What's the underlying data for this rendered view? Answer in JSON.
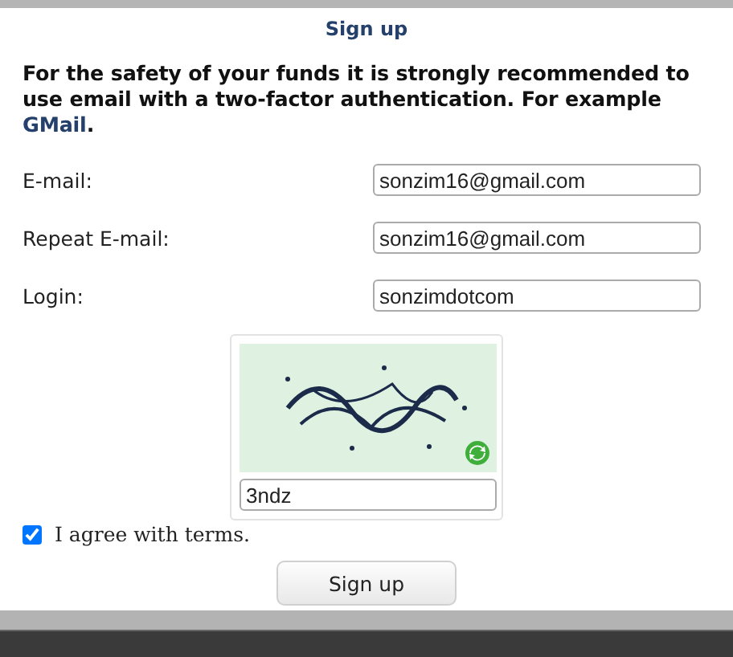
{
  "title": "Sign up",
  "intro": {
    "text": "For the safety of your funds it is strongly recommended to use email with a two-factor authentication. For example ",
    "link": "GMail",
    "after": "."
  },
  "fields": [
    {
      "label": "E-mail:",
      "value": "sonzim16@gmail.com"
    },
    {
      "label": "Repeat E-mail:",
      "value": "sonzim16@gmail.com"
    },
    {
      "label": "Login:",
      "value": "sonzimdotcom"
    }
  ],
  "captcha": {
    "kind": "picture",
    "value": "3ndz"
  },
  "agree": {
    "label": "I agree with terms.",
    "checked": true
  },
  "button": "Sign up"
}
